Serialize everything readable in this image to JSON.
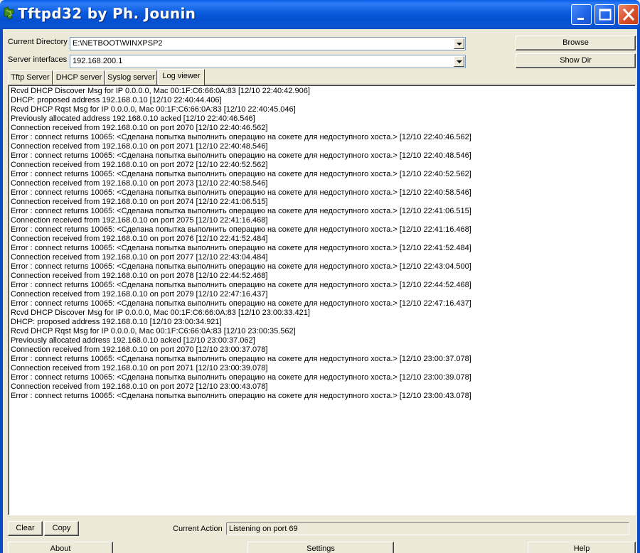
{
  "window": {
    "title": "Tftpd32 by Ph. Jounin"
  },
  "form": {
    "current_directory_label": "Current Directory",
    "current_directory_value": "E:\\NETBOOT\\WINXPSP2",
    "server_interfaces_label": "Server interfaces",
    "server_interfaces_value": "192.168.200.1",
    "browse_label": "Browse",
    "show_dir_label": "Show Dir"
  },
  "tabs": [
    {
      "label": "Tftp Server"
    },
    {
      "label": "DHCP server"
    },
    {
      "label": "Syslog server"
    },
    {
      "label": "Log viewer",
      "active": true
    }
  ],
  "log": {
    "lines": [
      "Rcvd DHCP Discover Msg for IP 0.0.0.0, Mac 00:1F:C6:66:0A:83 [12/10 22:40:42.906]",
      "DHCP: proposed address 192.168.0.10 [12/10 22:40:44.406]",
      "Rcvd DHCP Rqst Msg for IP 0.0.0.0, Mac 00:1F:C6:66:0A:83 [12/10 22:40:45.046]",
      "Previously allocated address 192.168.0.10 acked [12/10 22:40:46.546]",
      "Connection received from 192.168.0.10 on port 2070 [12/10 22:40:46.562]",
      "Error : connect returns 10065: <Сделана попытка выполнить операцию на сокете для недоступного хоста.> [12/10 22:40:46.562]",
      "Connection received from 192.168.0.10 on port 2071 [12/10 22:40:48.546]",
      "Error : connect returns 10065: <Сделана попытка выполнить операцию на сокете для недоступного хоста.> [12/10 22:40:48.546]",
      "Connection received from 192.168.0.10 on port 2072 [12/10 22:40:52.562]",
      "Error : connect returns 10065: <Сделана попытка выполнить операцию на сокете для недоступного хоста.> [12/10 22:40:52.562]",
      "Connection received from 192.168.0.10 on port 2073 [12/10 22:40:58.546]",
      "Error : connect returns 10065: <Сделана попытка выполнить операцию на сокете для недоступного хоста.> [12/10 22:40:58.546]",
      "Connection received from 192.168.0.10 on port 2074 [12/10 22:41:06.515]",
      "Error : connect returns 10065: <Сделана попытка выполнить операцию на сокете для недоступного хоста.> [12/10 22:41:06.515]",
      "Connection received from 192.168.0.10 on port 2075 [12/10 22:41:16.468]",
      "Error : connect returns 10065: <Сделана попытка выполнить операцию на сокете для недоступного хоста.> [12/10 22:41:16.468]",
      "Connection received from 192.168.0.10 on port 2076 [12/10 22:41:52.484]",
      "Error : connect returns 10065: <Сделана попытка выполнить операцию на сокете для недоступного хоста.> [12/10 22:41:52.484]",
      "Connection received from 192.168.0.10 on port 2077 [12/10 22:43:04.484]",
      "Error : connect returns 10065: <Сделана попытка выполнить операцию на сокете для недоступного хоста.> [12/10 22:43:04.500]",
      "Connection received from 192.168.0.10 on port 2078 [12/10 22:44:52.468]",
      "Error : connect returns 10065: <Сделана попытка выполнить операцию на сокете для недоступного хоста.> [12/10 22:44:52.468]",
      "Connection received from 192.168.0.10 on port 2079 [12/10 22:47:16.437]",
      "Error : connect returns 10065: <Сделана попытка выполнить операцию на сокете для недоступного хоста.> [12/10 22:47:16.437]",
      "Rcvd DHCP Discover Msg for IP 0.0.0.0, Mac 00:1F:C6:66:0A:83 [12/10 23:00:33.421]",
      "DHCP: proposed address 192.168.0.10 [12/10 23:00:34.921]",
      "Rcvd DHCP Rqst Msg for IP 0.0.0.0, Mac 00:1F:C6:66:0A:83 [12/10 23:00:35.562]",
      "Previously allocated address 192.168.0.10 acked [12/10 23:00:37.062]",
      "Connection received from 192.168.0.10 on port 2070 [12/10 23:00:37.078]",
      "Error : connect returns 10065: <Сделана попытка выполнить операцию на сокете для недоступного хоста.> [12/10 23:00:37.078]",
      "Connection received from 192.168.0.10 on port 2071 [12/10 23:00:39.078]",
      "Error : connect returns 10065: <Сделана попытка выполнить операцию на сокете для недоступного хоста.> [12/10 23:00:39.078]",
      "Connection received from 192.168.0.10 on port 2072 [12/10 23:00:43.078]",
      "Error : connect returns 10065: <Сделана попытка выполнить операцию на сокете для недоступного хоста.> [12/10 23:00:43.078]"
    ]
  },
  "footer": {
    "clear_label": "Clear",
    "copy_label": "Copy",
    "current_action_label": "Current Action",
    "current_action_value": "Listening on port 69",
    "about_label": "About",
    "settings_label": "Settings",
    "help_label": "Help"
  },
  "icons": {
    "app": "tftpd-app-icon",
    "minimize": "minimize-icon",
    "maximize": "maximize-icon",
    "close": "close-icon",
    "dropdown": "chevron-down-icon"
  },
  "colors": {
    "titlebar": "#0a5bdd",
    "close_button": "#d8502c",
    "face": "#ece9d8"
  }
}
